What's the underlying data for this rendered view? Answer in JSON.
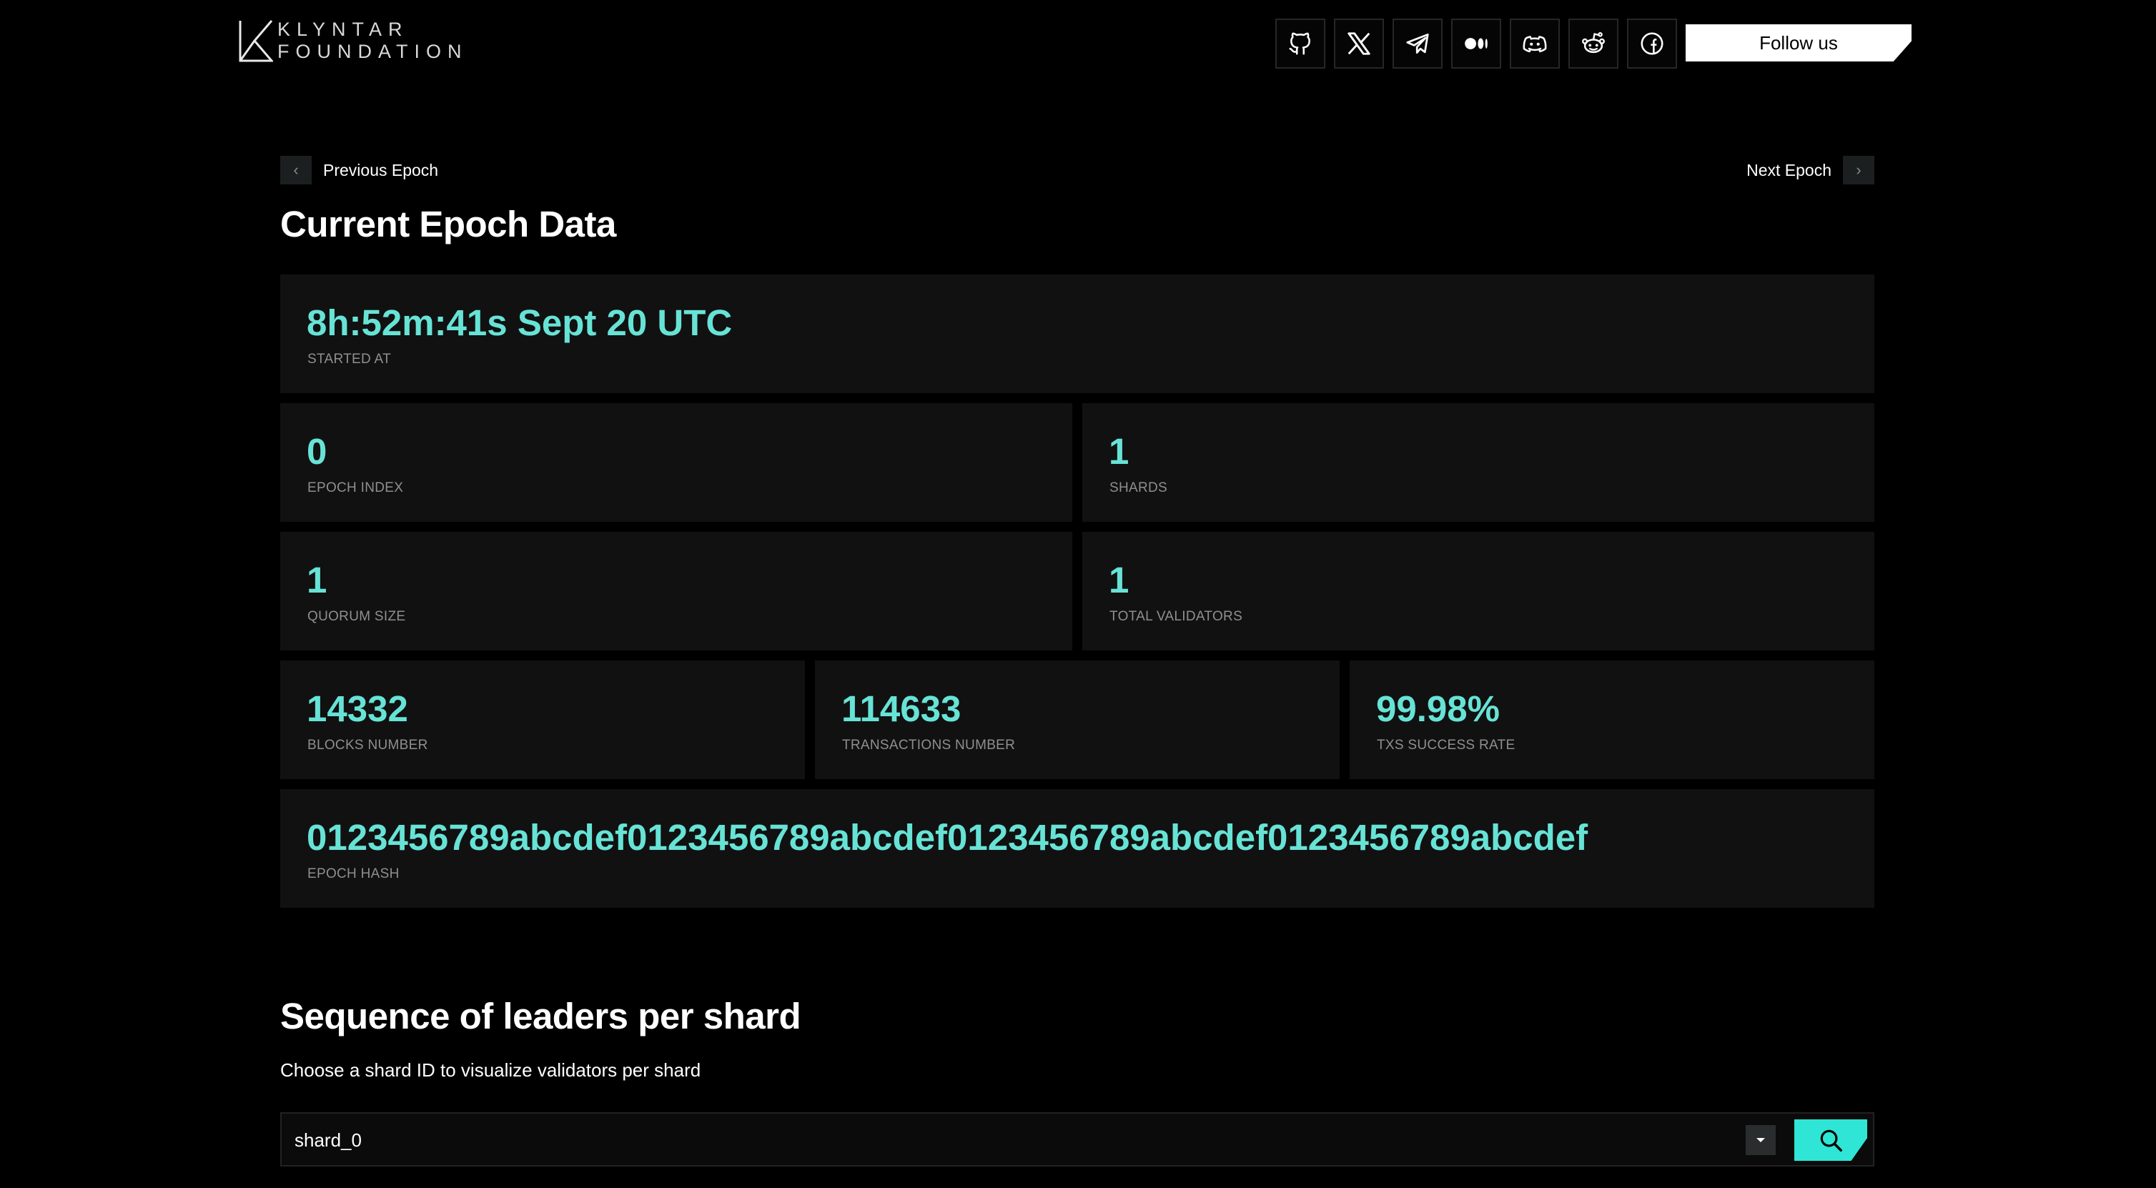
{
  "header": {
    "logo_line1": "KLYNTAR",
    "logo_line2": "FOUNDATION",
    "social_icons": [
      "github-icon",
      "x-icon",
      "telegram-icon",
      "medium-icon",
      "discord-icon",
      "reddit-icon",
      "facebook-icon"
    ],
    "follow_label": "Follow us"
  },
  "nav": {
    "prev_label": "Previous Epoch",
    "next_label": "Next Epoch"
  },
  "current": {
    "title": "Current Epoch Data",
    "started_at": {
      "value": "8h:52m:41s Sept 20 UTC",
      "label": "STARTED AT"
    },
    "epoch_index": {
      "value": "0",
      "label": "EPOCH INDEX"
    },
    "shards": {
      "value": "1",
      "label": "SHARDS"
    },
    "quorum_size": {
      "value": "1",
      "label": "QUORUM SIZE"
    },
    "total_validators": {
      "value": "1",
      "label": "TOTAL VALIDATORS"
    },
    "blocks_number": {
      "value": "14332",
      "label": "BLOCKS NUMBER"
    },
    "transactions_number": {
      "value": "114633",
      "label": "TRANSACTIONS NUMBER"
    },
    "txs_success_rate": {
      "value": "99.98%",
      "label": "TXS SUCCESS RATE"
    },
    "epoch_hash": {
      "value": "0123456789abcdef0123456789abcdef0123456789abcdef0123456789abcdef",
      "label": "EPOCH HASH"
    }
  },
  "sequence": {
    "title": "Sequence of leaders per shard",
    "description": "Choose a shard ID to visualize validators per shard",
    "selected_shard": "shard_0"
  },
  "colors": {
    "accent": "#67e3d6",
    "button_accent": "#2ee5d6",
    "card_bg": "#111111",
    "page_bg": "#000000"
  }
}
